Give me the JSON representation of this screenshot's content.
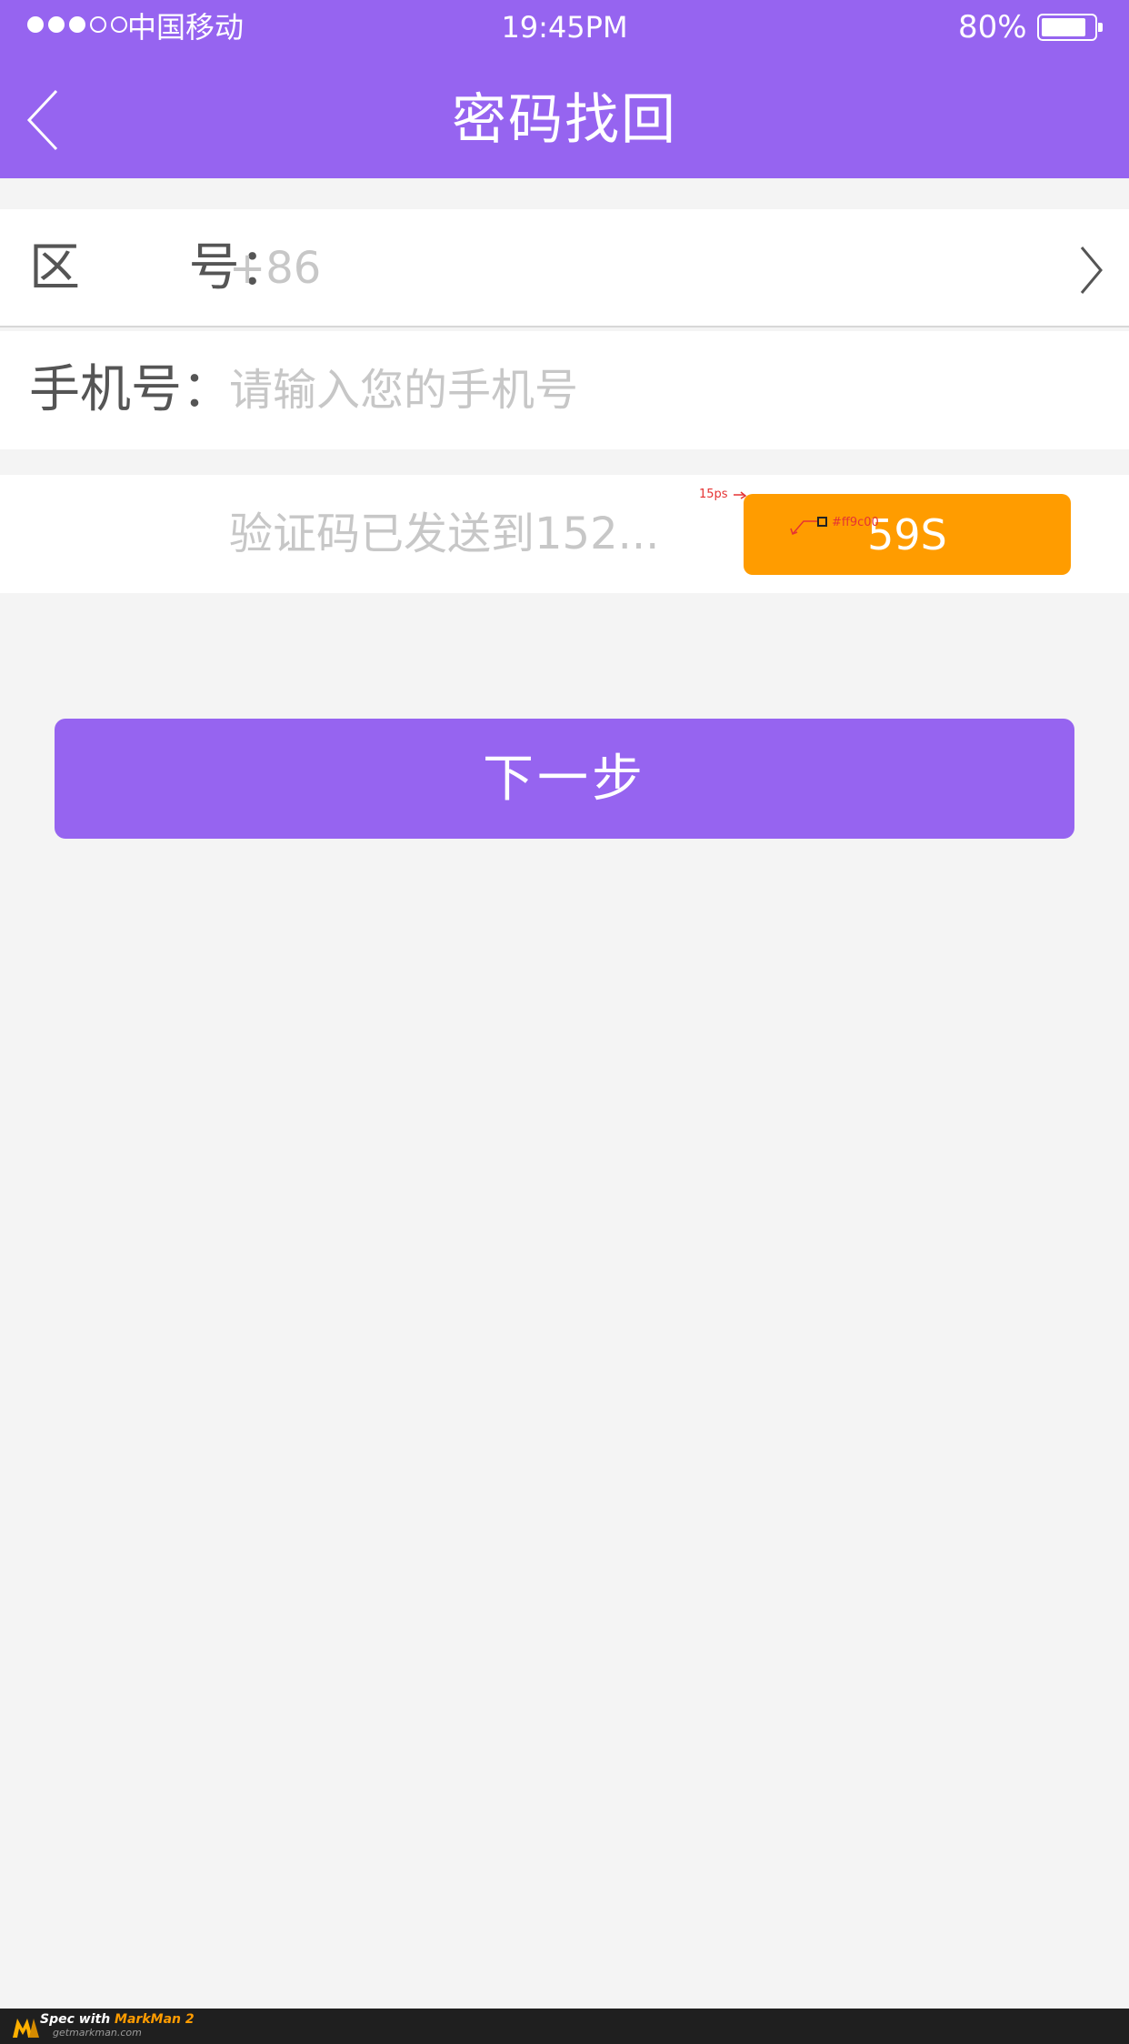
{
  "colors": {
    "primary": "#9664f0",
    "accent": "#ff9c00",
    "background": "#f4f4f4",
    "text": "#555555",
    "placeholder": "#c7c7c7"
  },
  "status_bar": {
    "signal_dots_filled": 3,
    "signal_dots_total": 5,
    "carrier": "中国移动",
    "time": "19:45PM",
    "battery_percent": "80%",
    "battery_level": 0.8
  },
  "nav": {
    "back_icon": "chevron-left-icon",
    "title": "密码找回"
  },
  "form": {
    "area_code": {
      "label_part1": "区",
      "label_part2": "号：",
      "value": "+86",
      "chevron_icon": "chevron-right-icon"
    },
    "phone": {
      "label": "手机号：",
      "placeholder": "请输入您的手机号"
    },
    "verification": {
      "placeholder": "验证码已发送到152...",
      "countdown_label": "59S"
    }
  },
  "next_button": {
    "label": "下一步"
  },
  "annotations": {
    "radius_label": "15ps",
    "color_label": "#ff9c00"
  },
  "footer": {
    "line1_prefix": "Spec with ",
    "line1_brand": "MarkMan 2",
    "line2": "getmarkman.com"
  }
}
